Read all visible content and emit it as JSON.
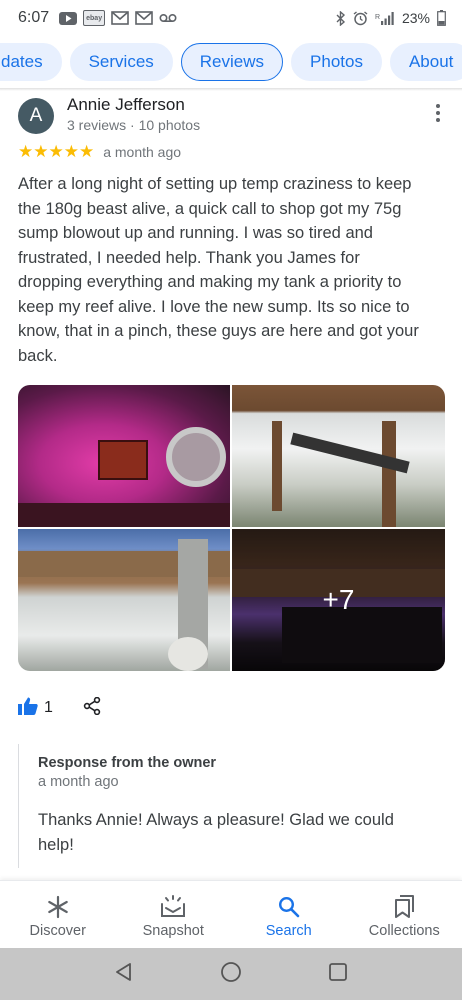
{
  "status_bar": {
    "time": "6:07",
    "battery": "23%",
    "ebay_label": "ebay"
  },
  "tabs": [
    {
      "label": "dates",
      "active": false
    },
    {
      "label": "Services",
      "active": false
    },
    {
      "label": "Reviews",
      "active": true
    },
    {
      "label": "Photos",
      "active": false
    },
    {
      "label": "About",
      "active": false
    }
  ],
  "review": {
    "avatar_letter": "A",
    "reviewer_name": "Annie Jefferson",
    "reviewer_meta": "3 reviews · 10 photos",
    "stars": "★★★★★",
    "rating": 5,
    "date": "a month ago",
    "text": "After a long night of setting up temp craziness to keep the 180g beast alive, a quick call to shop got my 75g sump blowout up and running.  I was so tired and frustrated, I needed help.  Thank you James for dropping everything and making my tank a priority to keep my reef alive.   I love the new sump.  Its so nice to know, that in a pinch, these guys are here and got your back.",
    "more_photos": "+7",
    "like_count": "1"
  },
  "owner_response": {
    "title": "Response from the owner",
    "date": "a month ago",
    "text": "Thanks Annie! Always a pleasure! Glad we could help!"
  },
  "bottom_nav": [
    {
      "label": "Discover",
      "icon": "asterisk-icon",
      "active": false
    },
    {
      "label": "Snapshot",
      "icon": "snapshot-icon",
      "active": false
    },
    {
      "label": "Search",
      "icon": "search-icon",
      "active": true
    },
    {
      "label": "Collections",
      "icon": "bookmark-icon",
      "active": false
    }
  ],
  "colors": {
    "accent": "#1a73e8",
    "star": "#fbbc04",
    "avatar": "#455a64"
  }
}
